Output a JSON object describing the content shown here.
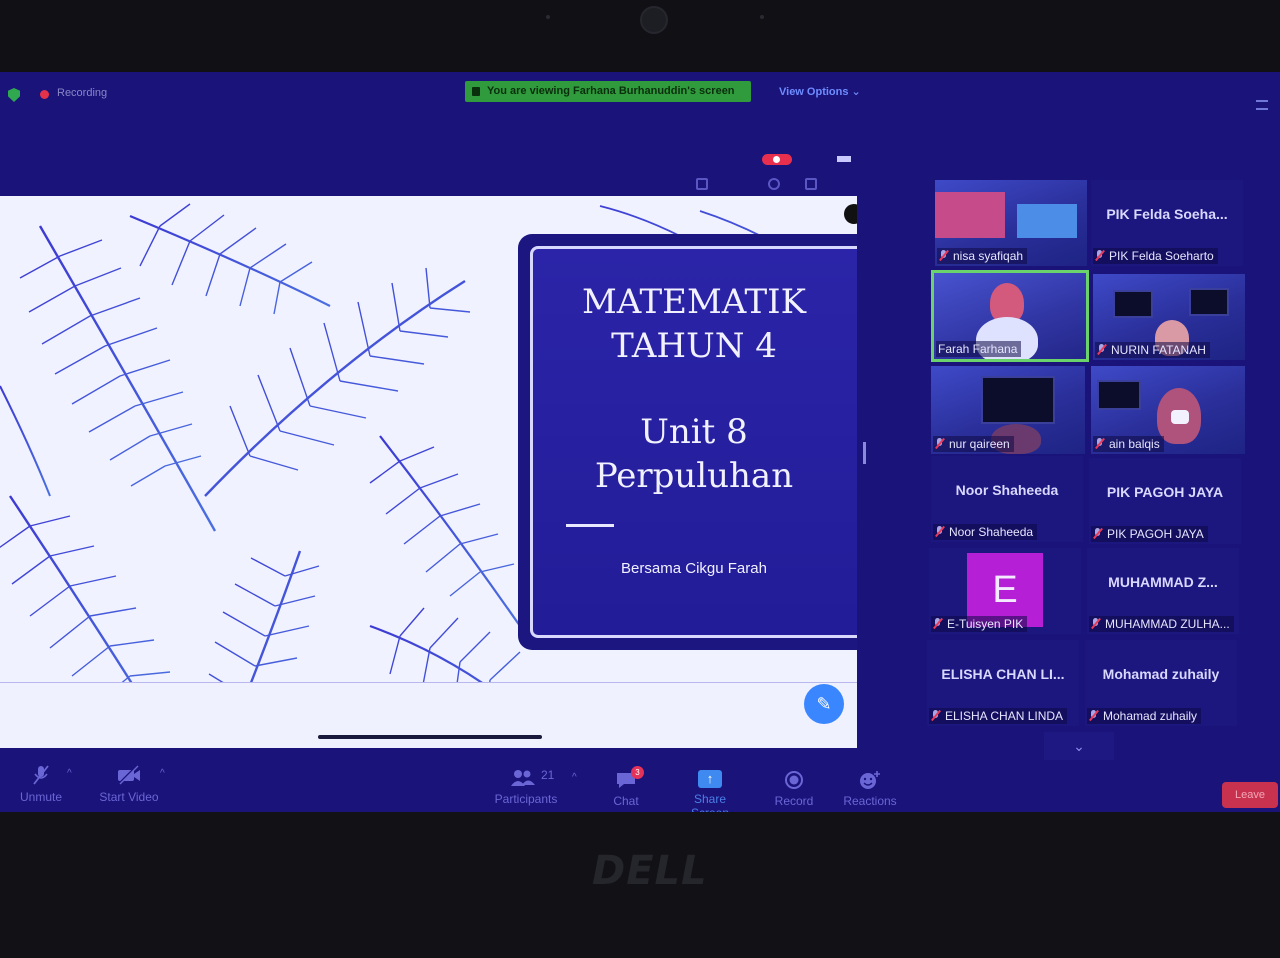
{
  "window": {
    "recording_label": "Recording",
    "share_banner": "You are viewing Farhana Burhanuddin's screen",
    "view_options_label": "View Options",
    "view_options_chevron": "⌄"
  },
  "slide": {
    "title_line1": "MATEMATIK",
    "title_line2": "TAHUN 4",
    "unit_line1": "Unit 8",
    "unit_line2": "Perpuluhan",
    "subtitle": "Bersama Cikgu Farah"
  },
  "gallery": {
    "tiles": [
      {
        "label": "nisa syafiqah",
        "kind": "video"
      },
      {
        "name": "PIK Felda Soeha...",
        "label": "PIK Felda Soeharto",
        "kind": "name"
      },
      {
        "label": "Farah Farhana",
        "kind": "video",
        "active_speaker": true
      },
      {
        "label": "NURIN FATANAH",
        "kind": "video"
      },
      {
        "label": "nur qaireen",
        "kind": "video"
      },
      {
        "label": "ain balqis",
        "kind": "video"
      },
      {
        "name": "Noor Shaheeda",
        "label": "Noor Shaheeda",
        "kind": "name"
      },
      {
        "name": "PIK PAGOH JAYA",
        "label": "PIK PAGOH JAYA",
        "kind": "name"
      },
      {
        "avatar_letter": "E",
        "label": "E-Tuisyen PIK",
        "kind": "avatar"
      },
      {
        "name": "MUHAMMAD Z...",
        "label": "MUHAMMAD ZULHA...",
        "kind": "name"
      },
      {
        "name": "ELISHA CHAN LI...",
        "label": "ELISHA CHAN LINDA",
        "kind": "name"
      },
      {
        "name": "Mohamad zuhaily",
        "label": "Mohamad zuhaily",
        "kind": "name"
      }
    ],
    "scroll_down_icon": "⌄"
  },
  "toolbar": {
    "unmute_label": "Unmute",
    "start_video_label": "Start Video",
    "participants_label": "Participants",
    "participants_count": "21",
    "chat_label": "Chat",
    "chat_badge": "3",
    "share_screen_label": "Share Screen",
    "record_label": "Record",
    "reactions_label": "Reactions",
    "leave_label": "Leave",
    "caret": "^"
  },
  "colors": {
    "share_banner": "#2f9b3c",
    "recording_dot": "#e2334a",
    "active_speaker_border": "#6ad36b",
    "avatar_e": "#b51fd6",
    "leave_button": "#c8324f",
    "accent_blue": "#3a86ff"
  },
  "icons": {
    "pencil": "✎",
    "share_arrow": "↑"
  }
}
